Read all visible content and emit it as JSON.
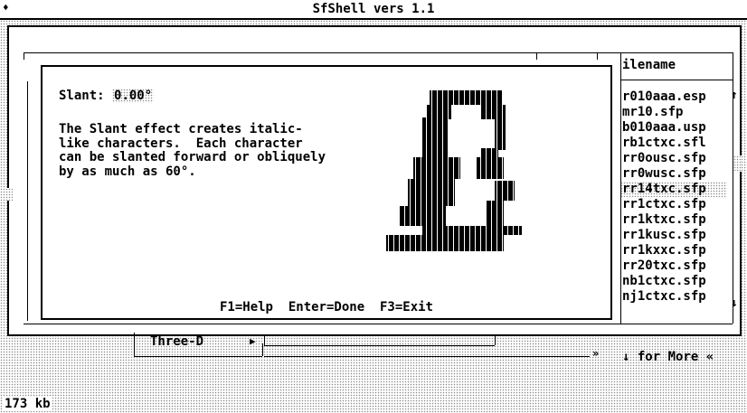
{
  "app": {
    "title": "SfShell vers 1.1",
    "system_menu": "♦"
  },
  "file_panel": {
    "header": "ilename",
    "files": [
      "r010aaa.esp",
      "mr10.sfp",
      "b010aaa.usp",
      "rb1ctxc.sfl",
      "rr0ousc.sfp",
      "rr0wusc.sfp",
      "rr14txc.sfp",
      "rr1ctxc.sfp",
      "rr1ktxc.sfp",
      "rr1kusc.sfp",
      "rr1kxxc.sfp",
      "rr20txc.sfp",
      "nb1ctxc.sfp",
      "nj1ctxc.sfp"
    ],
    "selected_index": 6,
    "scroll_up": "↑",
    "scroll_down": "↓",
    "more_hint": "↓ for More «"
  },
  "dialog": {
    "slant_label": "Slant:",
    "slant_value": "0.00°",
    "description": "The Slant effect creates italic-\nlike characters.  Each character\ncan be slanted forward or obliquely\nby as much as 60°.",
    "preview_glyph": "B",
    "hotkeys": "F1=Help  Enter=Done  F3=Exit"
  },
  "effect_bar": {
    "label": "Three-D",
    "arrow": "▶",
    "fill_arrow": "»"
  },
  "status": {
    "memory": "173 kb"
  }
}
